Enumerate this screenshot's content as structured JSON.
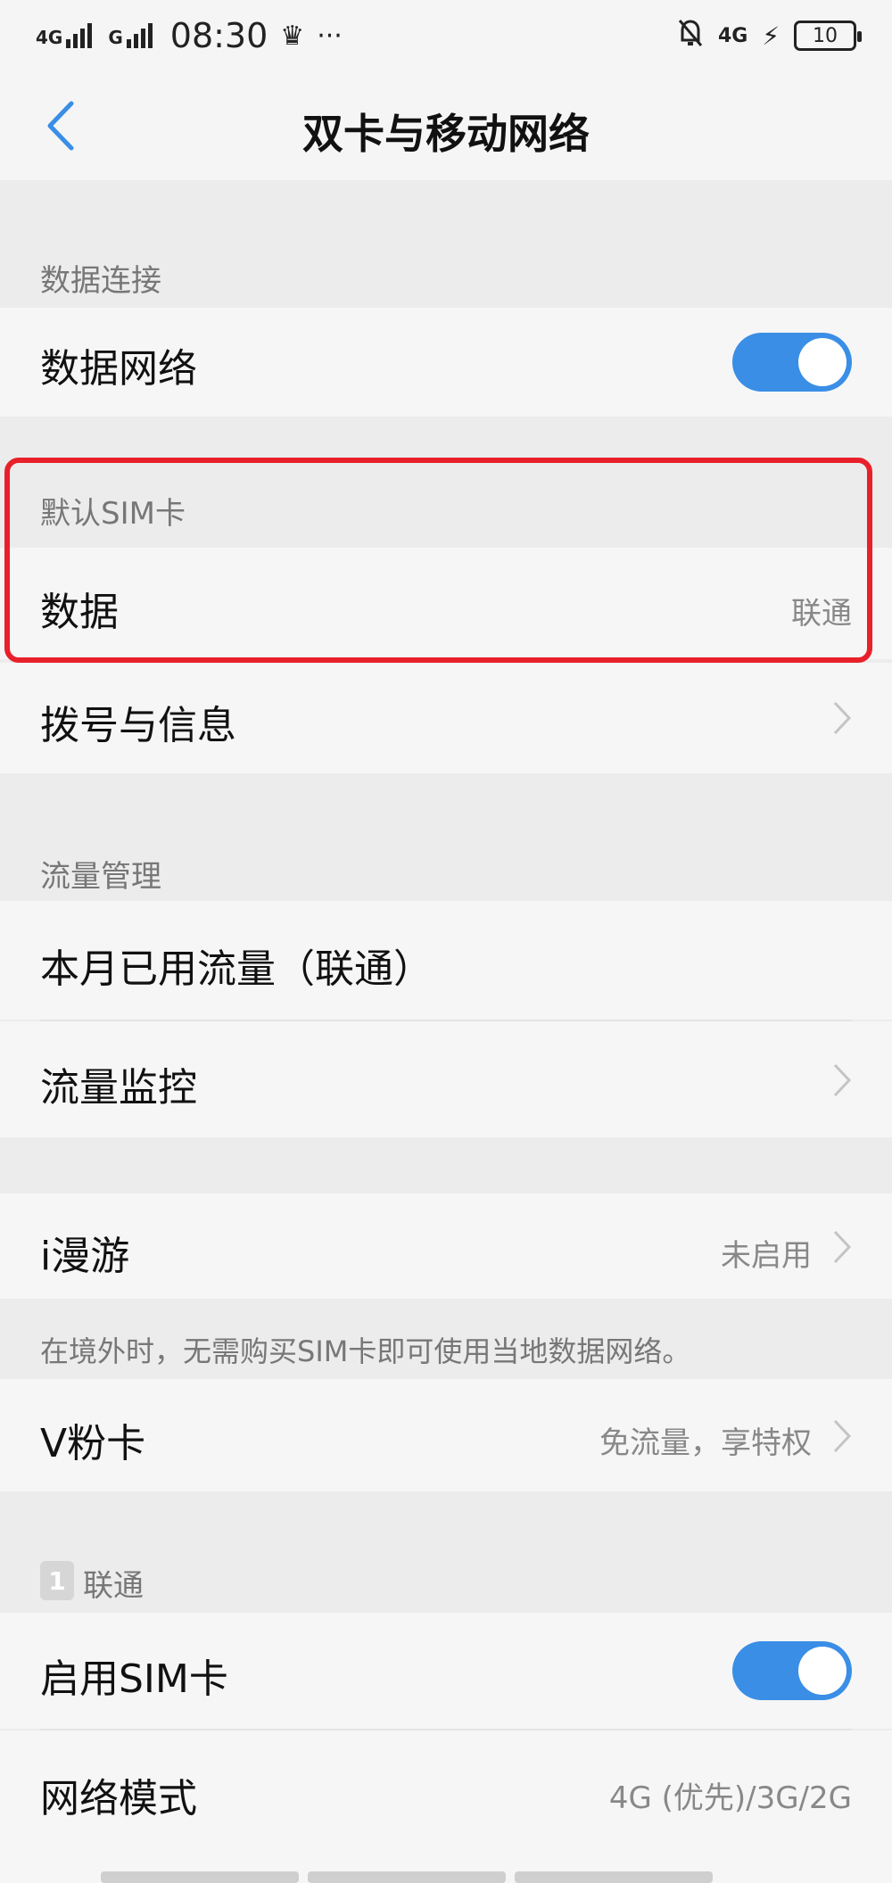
{
  "status_bar": {
    "network1": "4G",
    "network2": "G",
    "time": "08:30",
    "more": "···",
    "right_network": "4G",
    "battery": "10"
  },
  "header": {
    "title": "双卡与移动网络"
  },
  "data_connection": {
    "section_label": "数据连接",
    "data_network_label": "数据网络",
    "data_network_enabled": true
  },
  "default_sim": {
    "section_label": "默认SIM卡",
    "data_label": "数据",
    "data_value": "联通",
    "dial_label": "拨号与信息"
  },
  "traffic": {
    "section_label": "流量管理",
    "monthly_label": "本月已用流量（联通）",
    "monitor_label": "流量监控"
  },
  "roaming": {
    "label": "i漫游",
    "value": "未启用",
    "note": "在境外时，无需购买SIM卡即可使用当地数据网络。"
  },
  "vcard": {
    "label": "V粉卡",
    "value": "免流量，享特权"
  },
  "sim1": {
    "badge": "1",
    "section_label": "联通",
    "enable_label": "启用SIM卡",
    "enabled": true,
    "mode_label": "网络模式",
    "mode_value": "4G (优先)/3G/2G"
  },
  "colors": {
    "accent": "#3a8ee6",
    "highlight_box": "#e8202a"
  }
}
